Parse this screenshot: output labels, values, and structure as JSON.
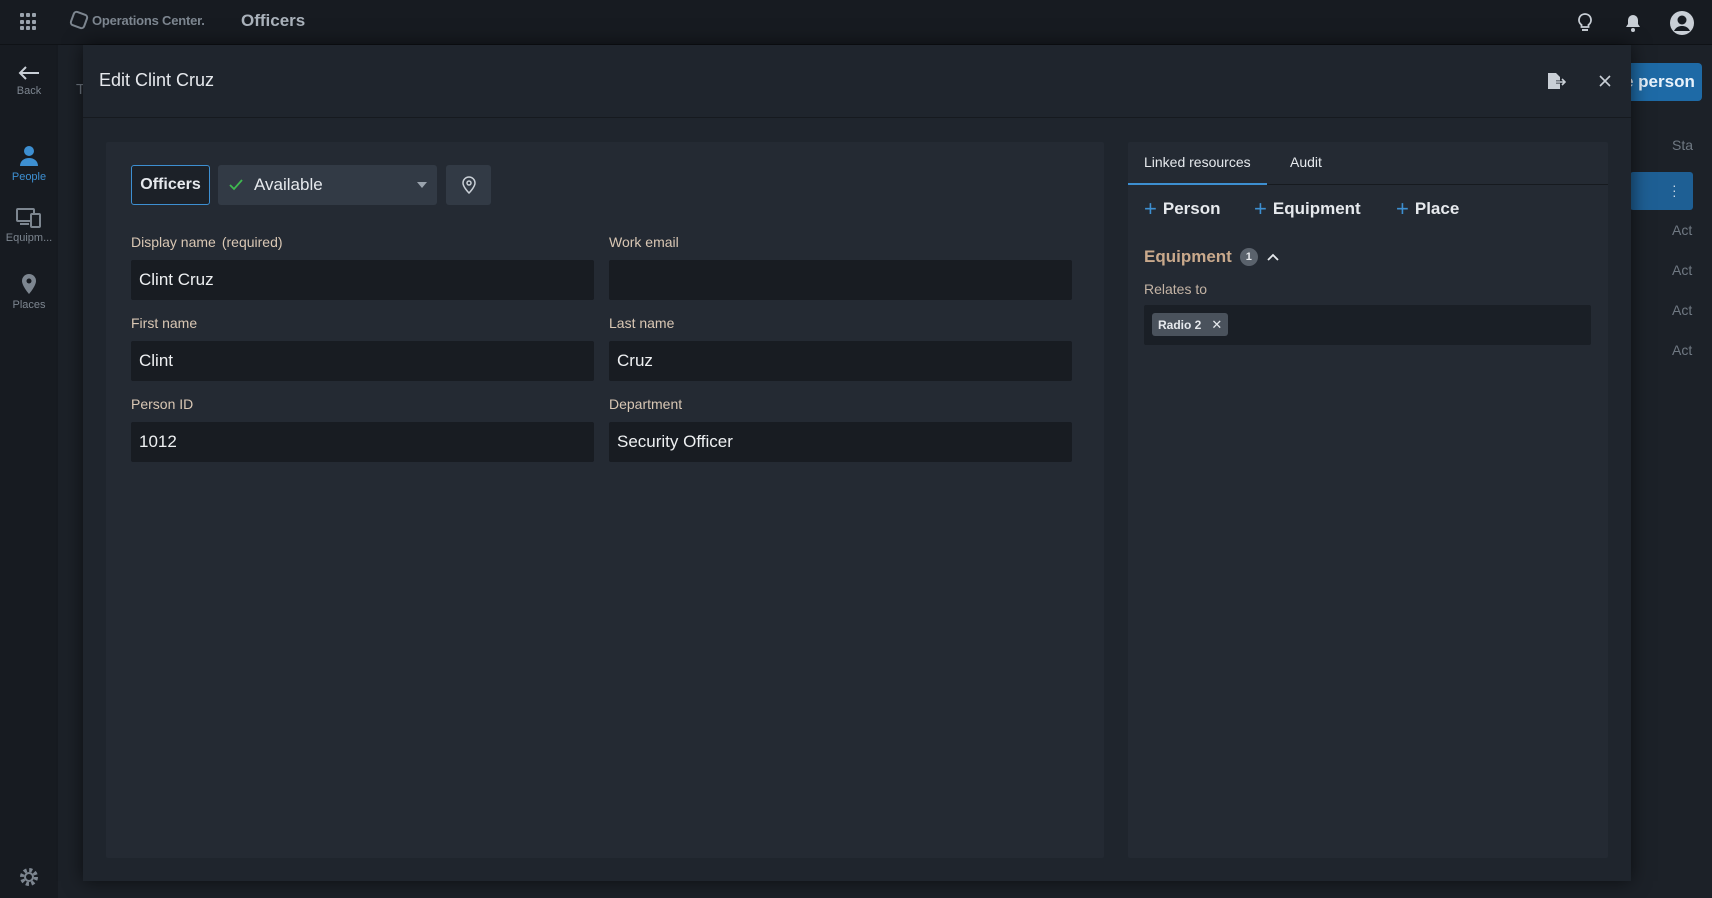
{
  "app": {
    "brand": "Operations Center.",
    "page_title": "Officers",
    "icons": [
      "apps-grid-icon",
      "lightbulb-icon",
      "bell-icon",
      "user-avatar-icon"
    ]
  },
  "rail": {
    "back_label": "Back",
    "items": [
      {
        "label": "People",
        "icon": "person-icon",
        "active": true
      },
      {
        "label": "Equipm...",
        "icon": "devices-icon",
        "active": false
      },
      {
        "label": "Places",
        "icon": "location-pin-icon",
        "active": false
      }
    ],
    "settings_icon": "gear-icon"
  },
  "background": {
    "add_button_label": "e person",
    "column_header": "Sta",
    "row_values": [
      "Act",
      "Act",
      "Act",
      "Act"
    ],
    "cut_off_letter": "T"
  },
  "modal": {
    "title": "Edit Clint Cruz",
    "type_chip": "Officers",
    "status": {
      "value": "Available",
      "color": "#3fb950"
    },
    "fields": {
      "display_name": {
        "label": "Display name",
        "note": "(required)",
        "value": "Clint Cruz"
      },
      "work_email": {
        "label": "Work email",
        "value": ""
      },
      "first_name": {
        "label": "First name",
        "value": "Clint"
      },
      "last_name": {
        "label": "Last name",
        "value": "Cruz"
      },
      "person_id": {
        "label": "Person ID",
        "value": "1012"
      },
      "department": {
        "label": "Department",
        "value": "Security Officer"
      }
    },
    "right": {
      "tabs": [
        {
          "label": "Linked resources",
          "active": true
        },
        {
          "label": "Audit",
          "active": false
        }
      ],
      "add_links": [
        {
          "label": "Person"
        },
        {
          "label": "Equipment"
        },
        {
          "label": "Place"
        }
      ],
      "section": {
        "title": "Equipment",
        "count": "1",
        "relates_label": "Relates to",
        "tags": [
          {
            "label": "Radio 2"
          }
        ]
      }
    }
  },
  "colors": {
    "accent": "#3d8fd1",
    "section_title": "#c9a98c"
  }
}
